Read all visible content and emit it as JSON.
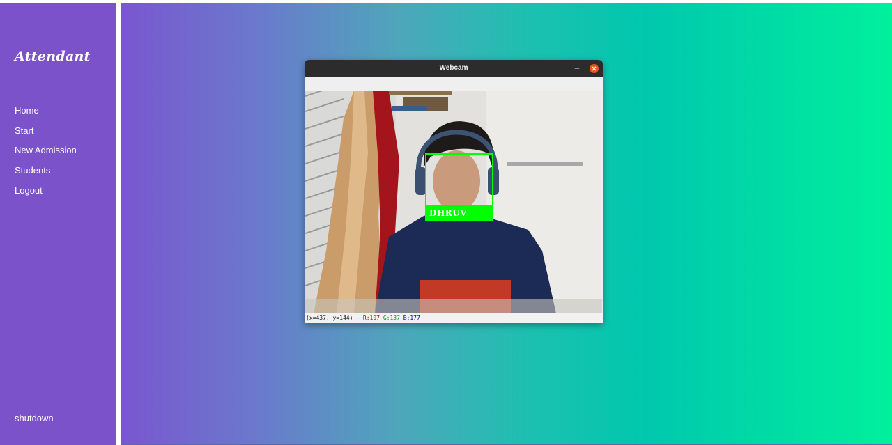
{
  "app": {
    "brand": "Attendant"
  },
  "sidebar": {
    "items": [
      {
        "label": "Home"
      },
      {
        "label": "Start"
      },
      {
        "label": "New Admission"
      },
      {
        "label": "Students"
      },
      {
        "label": "Logout"
      }
    ],
    "shutdown_label": "shutdown"
  },
  "webcam_window": {
    "title": "Webcam",
    "minimize_glyph": "–",
    "detection": {
      "name": "DHRUV",
      "box_color": "#00ff00"
    },
    "status": {
      "coords": "(x=437, y=144) ~",
      "r": "R:107",
      "g": "G:137",
      "b": "B:177"
    }
  },
  "colors": {
    "sidebar_bg": "#7b52c9",
    "gradient_start": "#7a56d0",
    "gradient_end": "#00f09c",
    "close_button": "#e95420"
  },
  "icons": [
    "minimize-icon",
    "close-icon"
  ]
}
